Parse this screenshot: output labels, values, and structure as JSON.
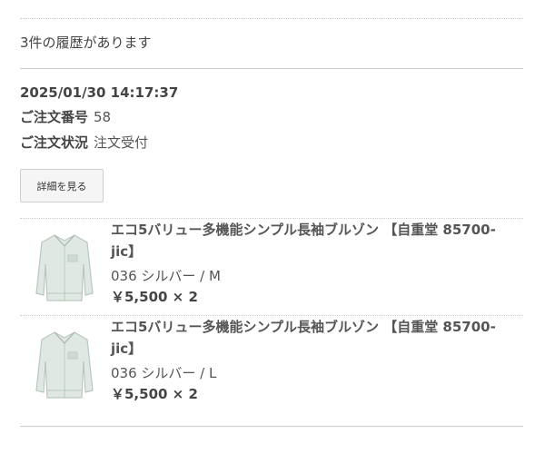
{
  "history": {
    "count_text": "3件の履歴があります"
  },
  "order": {
    "date": "2025/01/30 14:17:37",
    "number_label": "ご注文番号",
    "number_value": "58",
    "status_label": "ご注文状況",
    "status_value": "注文受付",
    "detail_button_label": "詳細を見る",
    "items": [
      {
        "title": "エコ5バリュー多機能シンプル長袖ブルゾン 【自重堂 85700-jic】",
        "variant": "036 シルバー / M",
        "price": "￥5,500 × 2",
        "thumbnail": "silver-work-jacket"
      },
      {
        "title": "エコ5バリュー多機能シンプル長袖ブルゾン 【自重堂 85700-jic】",
        "variant": "036 シルバー / L",
        "price": "￥5,500 × 2",
        "thumbnail": "silver-work-jacket"
      }
    ]
  },
  "colors": {
    "jacket": "#dfe8e2",
    "jacket_shade": "#b9c7bd"
  }
}
